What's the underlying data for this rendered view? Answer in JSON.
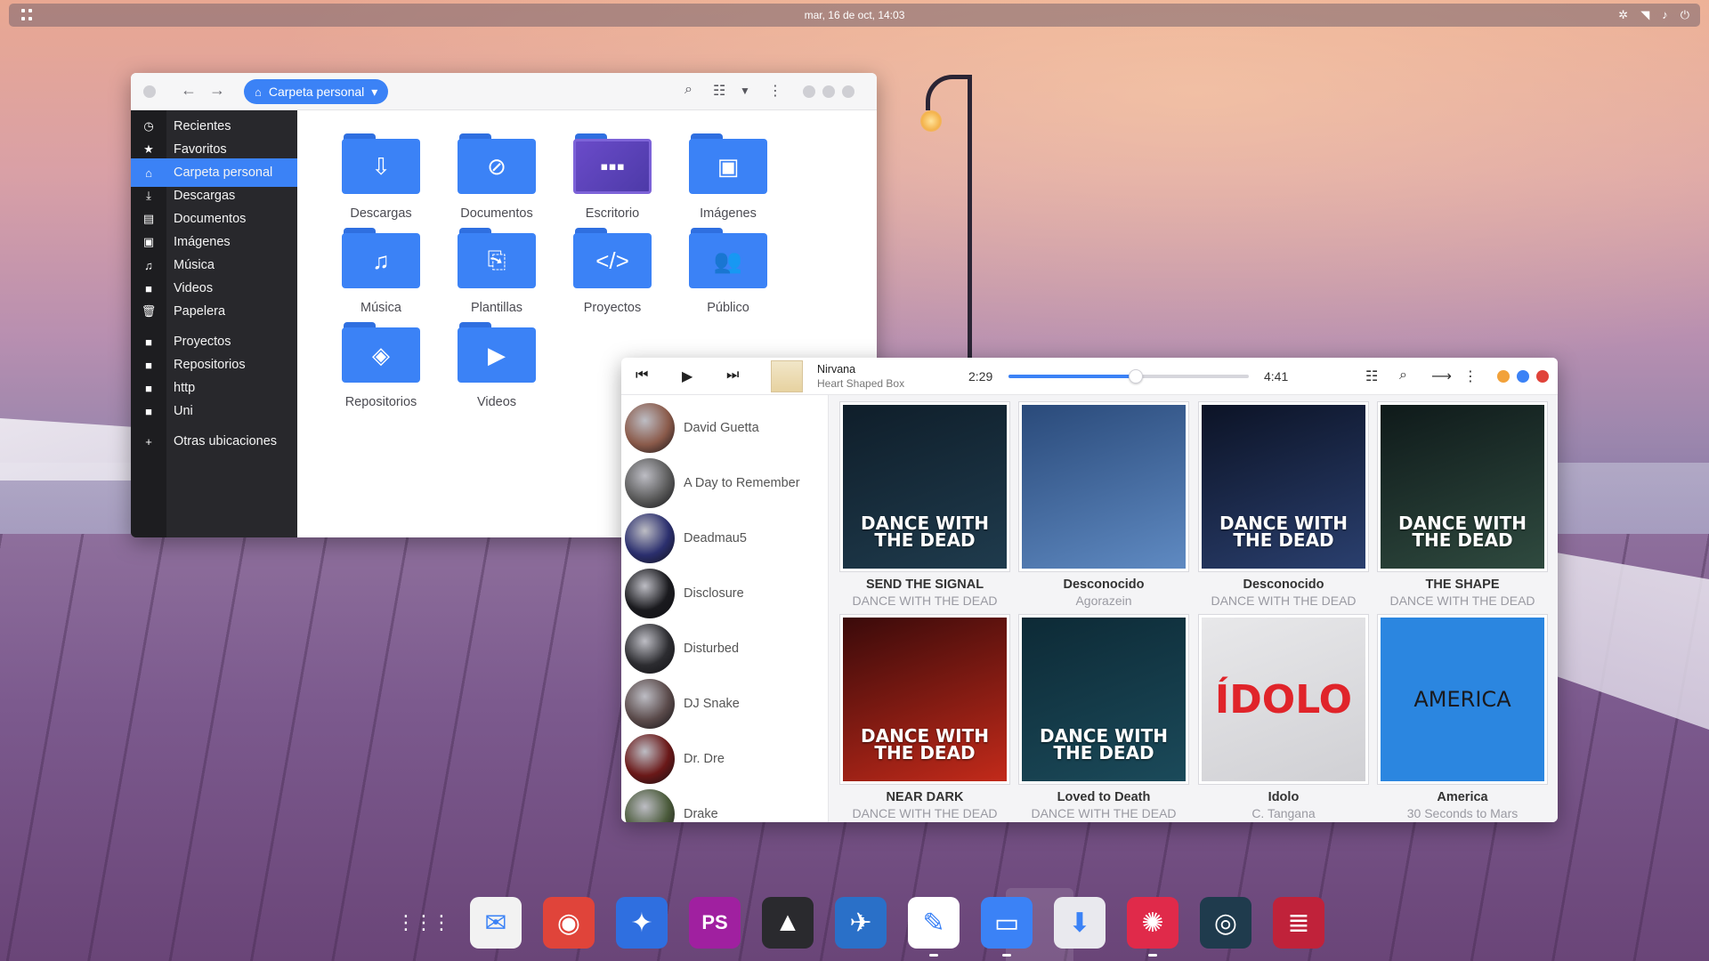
{
  "topbar": {
    "clock": "mar, 16 de oct, 14:03",
    "tray_icons": [
      "settings-icon",
      "wifi-icon",
      "volume-icon",
      "power-icon"
    ]
  },
  "file_manager": {
    "location_label": "Carpeta personal",
    "sidebar": [
      {
        "label": "Recientes",
        "icon": "clock-icon"
      },
      {
        "label": "Favoritos",
        "icon": "star-icon"
      },
      {
        "label": "Carpeta personal",
        "icon": "home-icon",
        "active": true
      },
      {
        "label": "Descargas",
        "icon": "download-icon"
      },
      {
        "label": "Documentos",
        "icon": "document-icon"
      },
      {
        "label": "Imágenes",
        "icon": "image-icon"
      },
      {
        "label": "Música",
        "icon": "music-icon"
      },
      {
        "label": "Videos",
        "icon": "video-icon"
      },
      {
        "label": "Papelera",
        "icon": "trash-icon"
      },
      {
        "label": "Proyectos",
        "icon": "folder-icon"
      },
      {
        "label": "Repositorios",
        "icon": "folder-icon"
      },
      {
        "label": "http",
        "icon": "folder-icon"
      },
      {
        "label": "Uni",
        "icon": "folder-icon"
      },
      {
        "label": "Otras ubicaciones",
        "icon": "plus-icon"
      }
    ],
    "folders": [
      {
        "name": "Descargas",
        "glyph": "⇩"
      },
      {
        "name": "Documentos",
        "glyph": "⊘"
      },
      {
        "name": "Escritorio",
        "glyph": "▪▪▪"
      },
      {
        "name": "Imágenes",
        "glyph": "▣"
      },
      {
        "name": "Música",
        "glyph": "♫"
      },
      {
        "name": "Plantillas",
        "glyph": "⎘"
      },
      {
        "name": "Proyectos",
        "glyph": "</>"
      },
      {
        "name": "Público",
        "glyph": "👥"
      },
      {
        "name": "Repositorios",
        "glyph": "◈"
      },
      {
        "name": "Videos",
        "glyph": "▶"
      }
    ]
  },
  "player": {
    "song": "Nirvana",
    "album": "Heart Shaped Box",
    "elapsed": "2:29",
    "total": "4:41",
    "progress": 0.53,
    "artists": [
      {
        "name": "David Guetta",
        "color": "#8a5a4a"
      },
      {
        "name": "A Day to Remember",
        "color": "#5b5b5b"
      },
      {
        "name": "Deadmau5",
        "color": "#2b2f6e"
      },
      {
        "name": "Disclosure",
        "color": "#1a1a1e"
      },
      {
        "name": "Disturbed",
        "color": "#2c2c30"
      },
      {
        "name": "DJ Snake",
        "color": "#5a4a4a"
      },
      {
        "name": "Dr. Dre",
        "color": "#6a1818"
      },
      {
        "name": "Drake",
        "color": "#4a5a3a"
      }
    ],
    "albums": [
      {
        "title": "SEND THE SIGNAL",
        "artist": "DANCE WITH THE DEAD",
        "cover_text": "DANCE WITH THE DEAD",
        "colors": [
          "#0f1e2a",
          "#1f3b4d"
        ]
      },
      {
        "title": "Desconocido",
        "artist": "Agorazein",
        "cover_text": "",
        "colors": [
          "#2a4a7a",
          "#5f8ac2"
        ]
      },
      {
        "title": "Desconocido",
        "artist": "DANCE WITH THE DEAD",
        "cover_text": "DANCE WITH THE DEAD",
        "colors": [
          "#0c1326",
          "#2a3f6e"
        ]
      },
      {
        "title": "THE SHAPE",
        "artist": "DANCE WITH THE DEAD",
        "cover_text": "DANCE WITH THE DEAD",
        "colors": [
          "#0f1a1a",
          "#2f4a3f"
        ]
      },
      {
        "title": "NEAR DARK",
        "artist": "DANCE WITH THE DEAD",
        "cover_text": "DANCE WITH THE DEAD",
        "colors": [
          "#3a0a0a",
          "#c22a1a"
        ]
      },
      {
        "title": "Loved to Death",
        "artist": "DANCE WITH THE DEAD",
        "cover_text": "DANCE WITH THE DEAD",
        "colors": [
          "#0d2a36",
          "#1b4a5a"
        ]
      },
      {
        "title": "Idolo",
        "artist": "C. Tangana",
        "cover_text": "ÍDOLO",
        "colors": [
          "#e8e8ea",
          "#d0d0d4"
        ]
      },
      {
        "title": "America",
        "artist": "30 Seconds to Mars",
        "cover_text": "AMERICA",
        "colors": [
          "#2b86e0",
          "#2b86e0"
        ]
      }
    ]
  },
  "dock": [
    {
      "name": "app-grid",
      "color": "transparent",
      "glyph": "⋮⋮⋮"
    },
    {
      "name": "mail",
      "color": "#f2f2f2",
      "glyph": "✉"
    },
    {
      "name": "chrome",
      "color": "#e0443a",
      "glyph": "◉"
    },
    {
      "name": "safari",
      "color": "#2f6fe0",
      "glyph": "✦"
    },
    {
      "name": "phpstorm",
      "color": "#a020a0",
      "glyph": "PS"
    },
    {
      "name": "inkscape",
      "color": "#2a2a2e",
      "glyph": "▲"
    },
    {
      "name": "thunderbird",
      "color": "#2a70c8",
      "glyph": "✈"
    },
    {
      "name": "text-editor",
      "color": "#ffffff",
      "glyph": "✎"
    },
    {
      "name": "files",
      "color": "#3b82f6",
      "glyph": "▭"
    },
    {
      "name": "software",
      "color": "#e9e9ee",
      "glyph": "⬇"
    },
    {
      "name": "music-player",
      "color": "#e02a4a",
      "glyph": "✺"
    },
    {
      "name": "audio",
      "color": "#1f3b4d",
      "glyph": "◎"
    },
    {
      "name": "notes",
      "color": "#c0223a",
      "glyph": "≣"
    }
  ]
}
